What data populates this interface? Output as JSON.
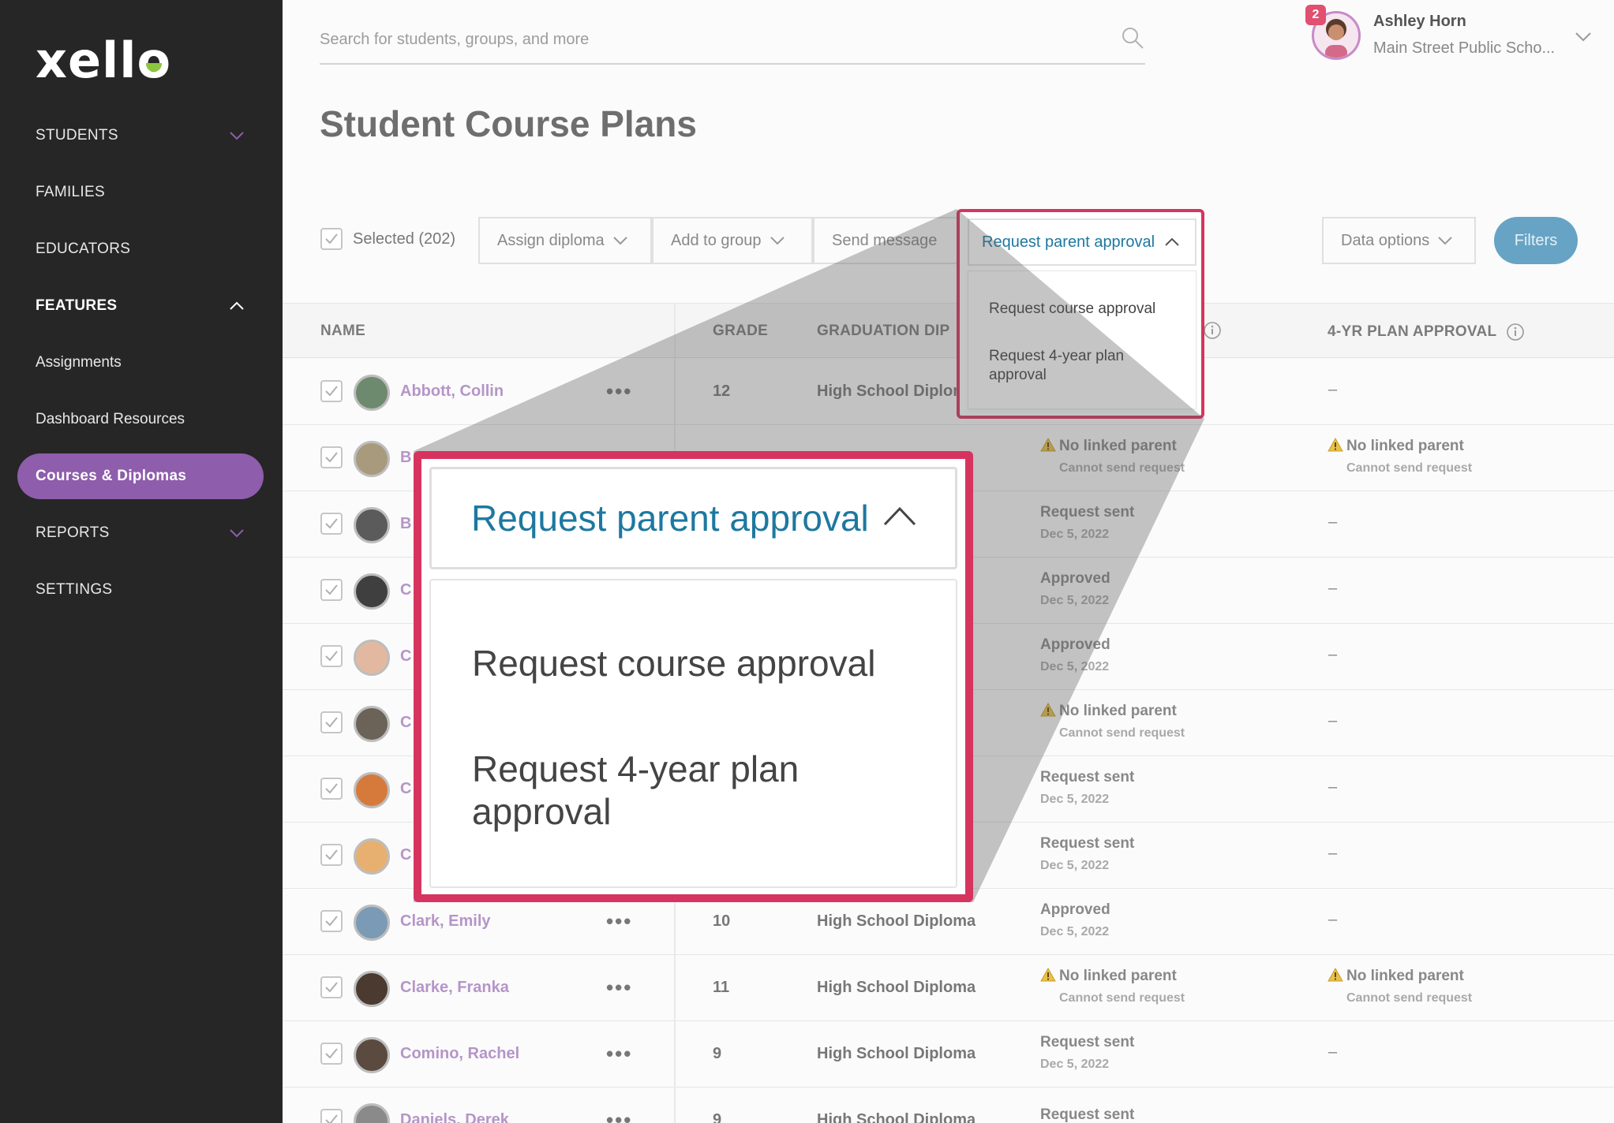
{
  "sidebar": {
    "logo": "xello",
    "items": [
      {
        "label": "STUDENTS"
      },
      {
        "label": "FAMILIES"
      },
      {
        "label": "EDUCATORS"
      },
      {
        "label": "FEATURES"
      },
      {
        "label": "Assignments"
      },
      {
        "label": "Dashboard Resources"
      },
      {
        "label": "Courses & Diplomas"
      },
      {
        "label": "REPORTS"
      },
      {
        "label": "SETTINGS"
      }
    ]
  },
  "header": {
    "search_placeholder": "Search for students, groups, and more",
    "user": {
      "name": "Ashley Horn",
      "school": "Main Street Public Scho...",
      "notifications": "2"
    }
  },
  "page": {
    "title": "Student Course Plans"
  },
  "toolbar": {
    "selected": "Selected (202)",
    "assign_diploma": "Assign diploma",
    "add_to_group": "Add to group",
    "send_message": "Send message",
    "request_parent_approval": "Request parent approval",
    "data_options": "Data options",
    "filters": "Filters"
  },
  "dropdown": {
    "options": [
      "Request course approval",
      "Request 4-year plan approval"
    ],
    "big_options": [
      "Request course approval",
      "Request 4-year plan\napproval"
    ]
  },
  "table": {
    "headers": {
      "name": "NAME",
      "grade": "GRADE",
      "diploma": "GRADUATION DIP",
      "plan_approval": "4-YR PLAN APPROVAL"
    },
    "rows": [
      {
        "name": "Abbott, Collin",
        "grade": "12",
        "diploma": "High School Diplon",
        "course_status": "",
        "course_sub": "",
        "plan_status": "–",
        "plan_sub": ""
      },
      {
        "name": "B",
        "grade": "",
        "diploma": "",
        "course_status": "No linked parent",
        "course_sub": "Cannot send request",
        "course_warn": true,
        "plan_status": "No linked parent",
        "plan_sub": "Cannot send request",
        "plan_warn": true
      },
      {
        "name": "B",
        "grade": "",
        "diploma": "",
        "course_status": "Request sent",
        "course_sub": "Dec 5, 2022",
        "plan_status": "–",
        "plan_sub": ""
      },
      {
        "name": "C",
        "grade": "",
        "diploma": "",
        "course_status": "Approved",
        "course_sub": "Dec 5, 2022",
        "plan_status": "–",
        "plan_sub": ""
      },
      {
        "name": "C",
        "grade": "",
        "diploma": "",
        "course_status": "Approved",
        "course_sub": "Dec 5, 2022",
        "plan_status": "–",
        "plan_sub": ""
      },
      {
        "name": "C",
        "grade": "",
        "diploma": "",
        "course_status": "No linked parent",
        "course_sub": "Cannot send request",
        "course_warn": true,
        "plan_status": "–",
        "plan_sub": ""
      },
      {
        "name": "C",
        "grade": "",
        "diploma": "",
        "course_status": "Request sent",
        "course_sub": "Dec 5, 2022",
        "plan_status": "–",
        "plan_sub": ""
      },
      {
        "name": "C",
        "grade": "",
        "diploma": "",
        "course_status": "Request sent",
        "course_sub": "Dec 5, 2022",
        "plan_status": "–",
        "plan_sub": ""
      },
      {
        "name": "Clark, Emily",
        "grade": "10",
        "diploma": "High School Diploma",
        "course_status": "Approved",
        "course_sub": "Dec 5, 2022",
        "plan_status": "–",
        "plan_sub": ""
      },
      {
        "name": "Clarke, Franka",
        "grade": "11",
        "diploma": "High School Diploma",
        "course_status": "No linked parent",
        "course_sub": "Cannot send request",
        "course_warn": true,
        "plan_status": "No linked parent",
        "plan_sub": "Cannot send request",
        "plan_warn": true
      },
      {
        "name": "Comino, Rachel",
        "grade": "9",
        "diploma": "High School Diploma",
        "course_status": "Request sent",
        "course_sub": "Dec 5, 2022",
        "plan_status": "–",
        "plan_sub": ""
      },
      {
        "name": "Daniels, Derek",
        "grade": "9",
        "diploma": "High School Diploma",
        "course_status": "Request sent",
        "course_sub": "",
        "plan_status": "",
        "plan_sub": ""
      }
    ]
  },
  "colors": {
    "accent": "#8e5dab",
    "highlight": "#d6345e",
    "link": "#1d78a0",
    "sidebar": "#262626"
  }
}
